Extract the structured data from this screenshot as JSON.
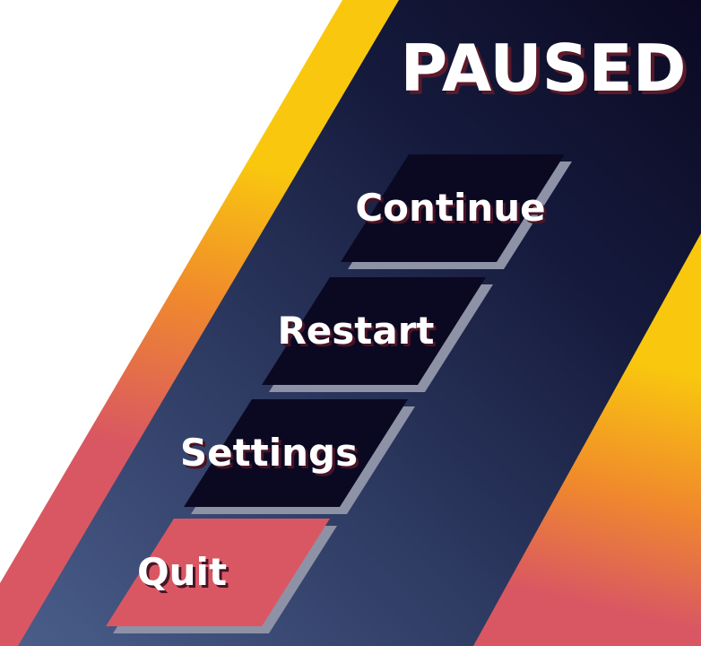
{
  "menu": {
    "title": "PAUSED",
    "items": [
      {
        "label": "Continue"
      },
      {
        "label": "Restart"
      },
      {
        "label": "Settings"
      },
      {
        "label": "Quit",
        "style": "danger"
      }
    ]
  },
  "colors": {
    "panel_dark": "#0b0922",
    "panel_light": "#3a4a72",
    "accent_yellow": "#f9c80e",
    "accent_orange": "#f08a2c",
    "accent_red": "#d95763",
    "button_face": "#0b0922",
    "button_edge": "#8e92a6",
    "quit_face": "#d95763"
  }
}
